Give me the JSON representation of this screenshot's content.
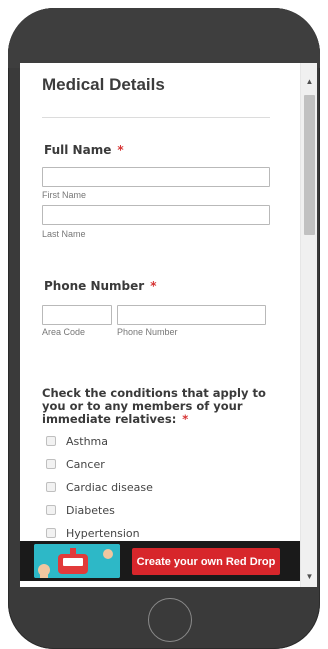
{
  "form": {
    "title": "Medical Details",
    "full_name": {
      "label": "Full Name",
      "required_mark": "*",
      "first_name_sublabel": "First Name",
      "last_name_sublabel": "Last Name"
    },
    "phone": {
      "label": "Phone Number",
      "required_mark": "*",
      "area_code_sublabel": "Area Code",
      "phone_number_sublabel": "Phone Number"
    },
    "conditions": {
      "question": "Check the conditions that apply to you or to any members of your immediate relatives:",
      "required_mark": "*",
      "options": [
        "Asthma",
        "Cancer",
        "Cardiac disease",
        "Diabetes",
        "Hypertension"
      ]
    }
  },
  "banner": {
    "cta_label": "Create your own Red Drop"
  },
  "colors": {
    "required": "#d63333",
    "cta": "#d7262b",
    "phone_body": "#3a3a3a"
  }
}
